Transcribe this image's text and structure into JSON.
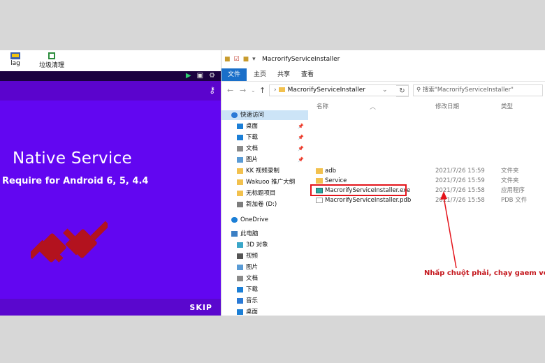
{
  "desktop": {
    "icons": [
      {
        "label": "lag"
      },
      {
        "label": "垃圾清理"
      }
    ]
  },
  "app": {
    "title": "Native Service",
    "subtitle": "Require for Android 6, 5, 4.4",
    "skip_label": "SKIP",
    "colors": {
      "main": "#6206f1",
      "topbar": "#5b04cd",
      "footer": "#5a07ce",
      "titlebar": "#1b0140",
      "plug": "#b3121e"
    }
  },
  "explorer": {
    "window_title": "MacrorifyServiceInstaller",
    "ribbon_tabs": [
      "文件",
      "主页",
      "共享",
      "查看"
    ],
    "address": "MacrorifyServiceInstaller",
    "search_placeholder": "搜索\"MacrorifyServiceInstaller\"",
    "columns": {
      "name": "名称",
      "date": "修改日期",
      "type": "类型"
    },
    "sidebar": [
      {
        "label": "快速访问",
        "icon": "star-icon",
        "selected": true
      },
      {
        "label": "桌面",
        "icon": "desktop-icon",
        "pinned": true
      },
      {
        "label": "下载",
        "icon": "download-icon",
        "pinned": true
      },
      {
        "label": "文档",
        "icon": "document-icon",
        "pinned": true
      },
      {
        "label": "图片",
        "icon": "picture-icon",
        "pinned": true
      },
      {
        "label": "KK 视频录制",
        "icon": "folder-icon"
      },
      {
        "label": "Wakuoo 推广大纲",
        "icon": "folder-icon"
      },
      {
        "label": "无标题项目",
        "icon": "folder-icon"
      },
      {
        "label": "新加卷 (D:)",
        "icon": "drive-icon"
      },
      {
        "label": "OneDrive",
        "icon": "cloud-icon"
      },
      {
        "label": "此电脑",
        "icon": "computer-icon"
      },
      {
        "label": "3D 对象",
        "icon": "cube-icon"
      },
      {
        "label": "视频",
        "icon": "video-icon"
      },
      {
        "label": "图片",
        "icon": "picture-icon"
      },
      {
        "label": "文档",
        "icon": "document-icon"
      },
      {
        "label": "下载",
        "icon": "download-icon"
      },
      {
        "label": "音乐",
        "icon": "music-icon"
      },
      {
        "label": "桌面",
        "icon": "desktop-icon"
      }
    ],
    "files": [
      {
        "name": "adb",
        "date": "2021/7/26 15:59",
        "type": "文件夹",
        "icon": "folder-icon"
      },
      {
        "name": "Service",
        "date": "2021/7/26 15:59",
        "type": "文件夹",
        "icon": "folder-icon"
      },
      {
        "name": "MacrorifyServiceInstaller.exe",
        "date": "2021/7/26 15:58",
        "type": "应用程序",
        "icon": "exe-icon"
      },
      {
        "name": "MacrorifyServiceInstaller.pdb",
        "date": "2021/7/26 15:58",
        "type": "PDB 文件",
        "icon": "file-icon"
      }
    ],
    "annotation": "Nhấp chuột phải, chạy gaem với quyền Quản trị Viên",
    "highlight_color": "#e4141b"
  }
}
